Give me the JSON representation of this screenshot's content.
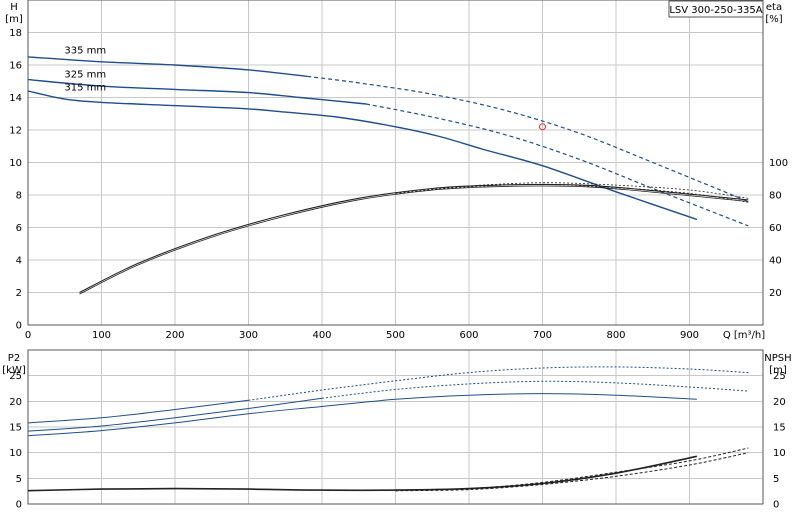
{
  "chart_data": [
    {
      "type": "line",
      "title": "LSV 300-250-335A",
      "ylabel_left": [
        "H",
        "[m]"
      ],
      "ylabel_right": [
        "eta",
        "[%]"
      ],
      "xlabel": "Q [m³/h]",
      "xlim": [
        0,
        1000
      ],
      "ylim": [
        0,
        20
      ],
      "ylim_right": [
        0,
        200
      ],
      "xticks": [
        0,
        100,
        200,
        300,
        400,
        500,
        600,
        700,
        800,
        900
      ],
      "yticks": [
        0,
        2,
        4,
        6,
        8,
        10,
        12,
        14,
        16,
        18
      ],
      "yticks_right": [
        20,
        40,
        60,
        80,
        100
      ],
      "grid": true,
      "colors": {
        "head": "#1f4e8c",
        "eff": "#222222",
        "point": "#e0303a"
      },
      "series": [
        {
          "name": "335 mm",
          "label_at": [
            25,
            16.6
          ],
          "x": [
            0,
            100,
            200,
            300,
            380
          ],
          "y": [
            16.5,
            16.2,
            16.0,
            15.7,
            15.3
          ],
          "dashed_x": [
            380,
            450,
            550,
            650,
            750,
            850,
            980
          ],
          "dashed_y": [
            15.3,
            14.9,
            14.2,
            13.2,
            11.8,
            10.0,
            7.6
          ]
        },
        {
          "name": "325 mm",
          "label_at": [
            25,
            15.1
          ],
          "x": [
            0,
            100,
            200,
            300,
            370,
            460
          ],
          "y": [
            15.1,
            14.7,
            14.5,
            14.3,
            14.0,
            13.6
          ],
          "dashed_x": [
            460,
            550,
            650,
            750,
            850,
            980
          ],
          "dashed_y": [
            13.6,
            12.8,
            11.7,
            10.2,
            8.4,
            6.1
          ]
        },
        {
          "name": "315 mm",
          "label_at": [
            25,
            14.3
          ],
          "x": [
            0,
            50,
            100,
            200,
            300,
            350,
            420,
            500,
            560,
            620,
            700,
            800,
            910
          ],
          "y": [
            14.4,
            13.9,
            13.7,
            13.5,
            13.3,
            13.1,
            12.8,
            12.2,
            11.6,
            10.8,
            9.8,
            8.2,
            6.5
          ]
        },
        {
          "kind": "efficiency",
          "x": [
            70,
            150,
            250,
            350,
            450,
            550,
            630,
            700,
            760,
            820,
            890,
            980
          ],
          "y": [
            20,
            38,
            55,
            68,
            78,
            84,
            86,
            86.5,
            86,
            84,
            81,
            77
          ]
        },
        {
          "kind": "efficiency-variants",
          "x": [
            500,
            600,
            700,
            800,
            900,
            980
          ],
          "y": [
            81,
            85,
            86.5,
            84.5,
            81,
            75.5
          ]
        }
      ],
      "duty_point": {
        "x": 700,
        "y": 12.2
      }
    },
    {
      "type": "line",
      "ylabel_left": [
        "P2",
        "[kW]"
      ],
      "ylabel_right": [
        "NPSH",
        "[m]"
      ],
      "xlim": [
        0,
        1000
      ],
      "ylim": [
        0,
        30
      ],
      "yticks": [
        0,
        5,
        10,
        15,
        20,
        25
      ],
      "yticks_right": [
        0,
        5,
        10,
        15,
        20,
        25
      ],
      "grid": true,
      "colors": {
        "power": "#1f4e8c",
        "npsh": "#222222"
      },
      "series": [
        {
          "kind": "power",
          "x": [
            0,
            100,
            200,
            300,
            400,
            500,
            600,
            700,
            800,
            900,
            980
          ],
          "y": [
            15.8,
            16.8,
            18.4,
            20.2,
            22.2,
            24.0,
            25.6,
            26.5,
            26.7,
            26.3,
            25.6
          ],
          "dashed_from": 380
        },
        {
          "kind": "power",
          "x": [
            0,
            100,
            200,
            300,
            400,
            500,
            600,
            700,
            800,
            900,
            980
          ],
          "y": [
            14.2,
            15.2,
            16.8,
            18.6,
            20.6,
            22.3,
            23.4,
            23.9,
            23.6,
            22.8,
            22.0
          ],
          "dashed_from": 460
        },
        {
          "kind": "power",
          "x": [
            0,
            100,
            200,
            300,
            400,
            500,
            600,
            700,
            800,
            910
          ],
          "y": [
            13.3,
            14.3,
            15.8,
            17.6,
            19.0,
            20.4,
            21.2,
            21.5,
            21.2,
            20.4
          ]
        },
        {
          "kind": "npsh",
          "x": [
            0,
            100,
            200,
            300,
            400,
            500,
            600,
            700,
            800,
            910
          ],
          "y": [
            2.6,
            2.9,
            3.0,
            2.9,
            2.7,
            2.7,
            3.0,
            4.0,
            6.0,
            9.3
          ]
        },
        {
          "kind": "npsh",
          "x": [
            500,
            600,
            700,
            800,
            900,
            980
          ],
          "y": [
            2.6,
            3.0,
            4.2,
            6.2,
            8.4,
            10.9
          ],
          "dashed": true
        },
        {
          "kind": "npsh",
          "x": [
            500,
            600,
            700,
            800,
            900,
            980
          ],
          "y": [
            2.6,
            2.8,
            3.8,
            5.4,
            7.6,
            10.0
          ],
          "dashed": true
        }
      ]
    }
  ]
}
